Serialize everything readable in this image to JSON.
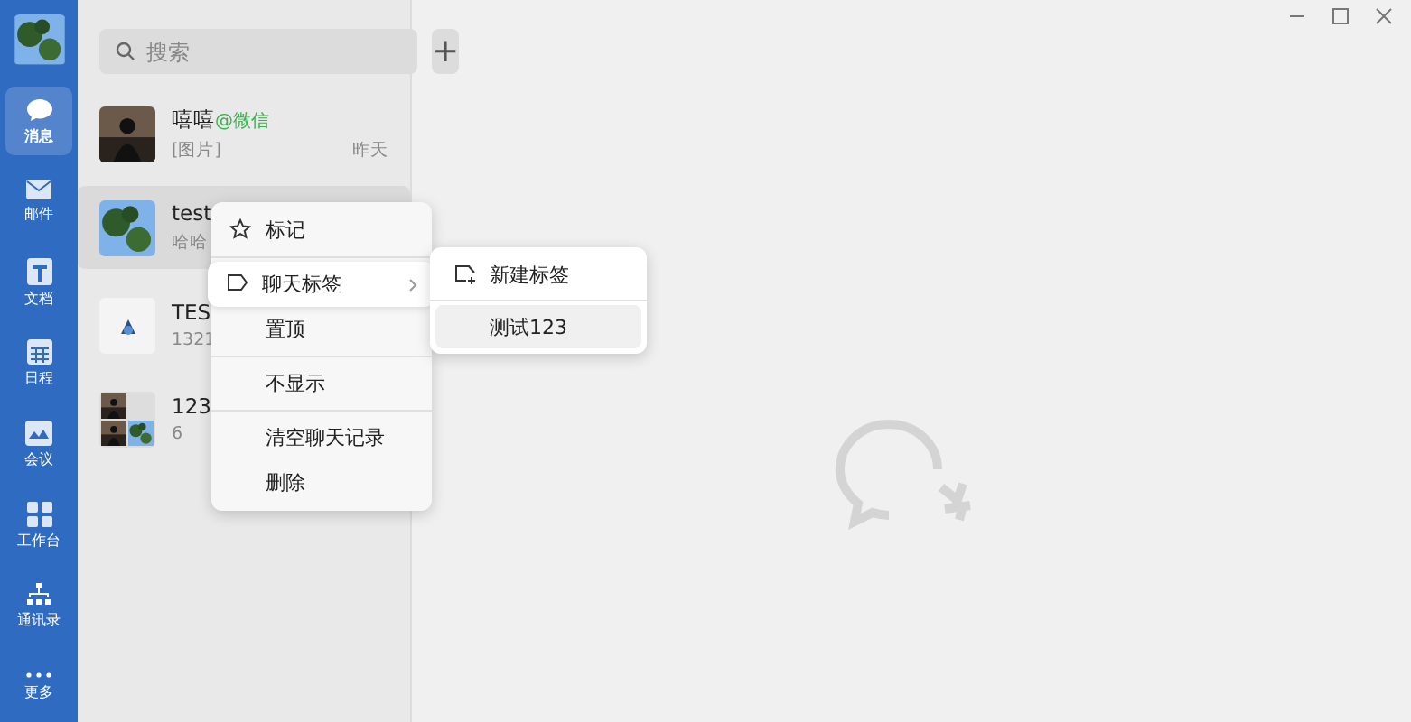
{
  "rail": {
    "items": [
      {
        "label": "消息",
        "selected": true
      },
      {
        "label": "邮件",
        "selected": false
      },
      {
        "label": "文档",
        "selected": false
      },
      {
        "label": "日程",
        "selected": false
      },
      {
        "label": "会议",
        "selected": false
      },
      {
        "label": "工作台",
        "selected": false
      },
      {
        "label": "通讯录",
        "selected": false
      },
      {
        "label": "更多",
        "selected": false
      }
    ]
  },
  "search": {
    "placeholder": "搜索"
  },
  "add_button": "+",
  "conversations": [
    {
      "name": "嘻嘻",
      "source": "@微信",
      "preview": "[图片]",
      "time": "昨天",
      "selected": false
    },
    {
      "name": "test",
      "preview": "哈哈",
      "selected": true
    },
    {
      "name": "TES",
      "preview": "1321",
      "selected": false
    },
    {
      "name": "123",
      "preview": "6",
      "selected": false
    }
  ],
  "context_menu": {
    "items": [
      {
        "label": "标记",
        "has_submenu": false,
        "highlighted": false
      },
      {
        "label": "聊天标签",
        "has_submenu": true,
        "highlighted": true
      },
      {
        "label": "置顶",
        "has_submenu": false,
        "highlighted": false
      },
      {
        "label": "不显示",
        "has_submenu": false,
        "highlighted": false
      },
      {
        "label": "清空聊天记录",
        "has_submenu": false,
        "highlighted": false
      },
      {
        "label": "删除",
        "has_submenu": false,
        "highlighted": false
      }
    ],
    "submenu": [
      {
        "label": "新建标签",
        "highlighted": false
      },
      {
        "label": "测试123",
        "highlighted": true
      }
    ]
  }
}
